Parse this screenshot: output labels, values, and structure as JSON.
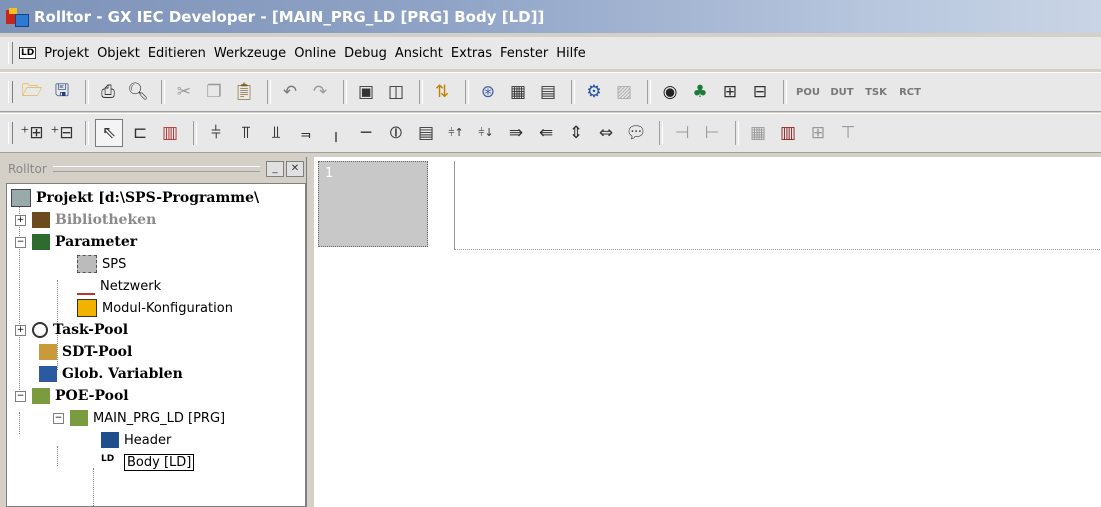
{
  "window": {
    "title": "Rolltor - GX IEC Developer - [MAIN_PRG_LD [PRG] Body [LD]]"
  },
  "menubar": {
    "items": [
      {
        "label": "Projekt"
      },
      {
        "label": "Objekt"
      },
      {
        "label": "Editieren"
      },
      {
        "label": "Werkzeuge"
      },
      {
        "label": "Online"
      },
      {
        "label": "Debug"
      },
      {
        "label": "Ansicht"
      },
      {
        "label": "Extras"
      },
      {
        "label": "Fenster"
      },
      {
        "label": "Hilfe"
      }
    ]
  },
  "toolbar1": {
    "buttons": [
      "open-icon",
      "save-icon",
      "print-icon",
      "print-preview-icon",
      "cut-icon",
      "copy-icon",
      "paste-icon",
      "undo-icon",
      "redo-icon",
      "properties-icon",
      "check-icon",
      "compile-icon",
      "transfer-icon",
      "monitor-icon",
      "list-icon",
      "debug-icon",
      "plc-icon",
      "online-icon",
      "network-icon",
      "io-icon",
      "device-icon"
    ],
    "small_buttons": [
      "POU",
      "DUT",
      "TSK",
      "RCT"
    ]
  },
  "toolbar2": {
    "buttons": [
      "insert-rung-before-icon",
      "insert-rung-after-icon",
      "select-icon",
      "contact-mode-icon",
      "instruction-icon",
      "no-contact-icon",
      "nc-contact-icon",
      "parallel-no-icon",
      "parallel-nc-icon",
      "vertical-line-icon",
      "horizontal-line-icon",
      "coil-icon",
      "function-block-icon",
      "rising-edge-icon",
      "falling-edge-icon",
      "jump-icon",
      "return-icon",
      "up-down-icon",
      "left-right-icon",
      "comment-icon",
      "invert-icon",
      "set-icon",
      "var-icon",
      "table-icon",
      "ladder-icon",
      "tree-icon"
    ]
  },
  "leftpanel": {
    "title": "Rolltor",
    "tree": {
      "root": "Projekt [d:\\SPS-Programme\\",
      "bibliotheken": "Bibliotheken",
      "parameter": "Parameter",
      "sps": "SPS",
      "netzwerk": "Netzwerk",
      "modul": "Modul-Konfiguration",
      "taskpool": "Task-Pool",
      "sdtpool": "SDT-Pool",
      "globvar": "Glob. Variablen",
      "poepool": "POE-Pool",
      "mainprg": "MAIN_PRG_LD [PRG]",
      "header": "Header",
      "body": "Body [LD]"
    }
  },
  "editor": {
    "network_number": "1"
  }
}
